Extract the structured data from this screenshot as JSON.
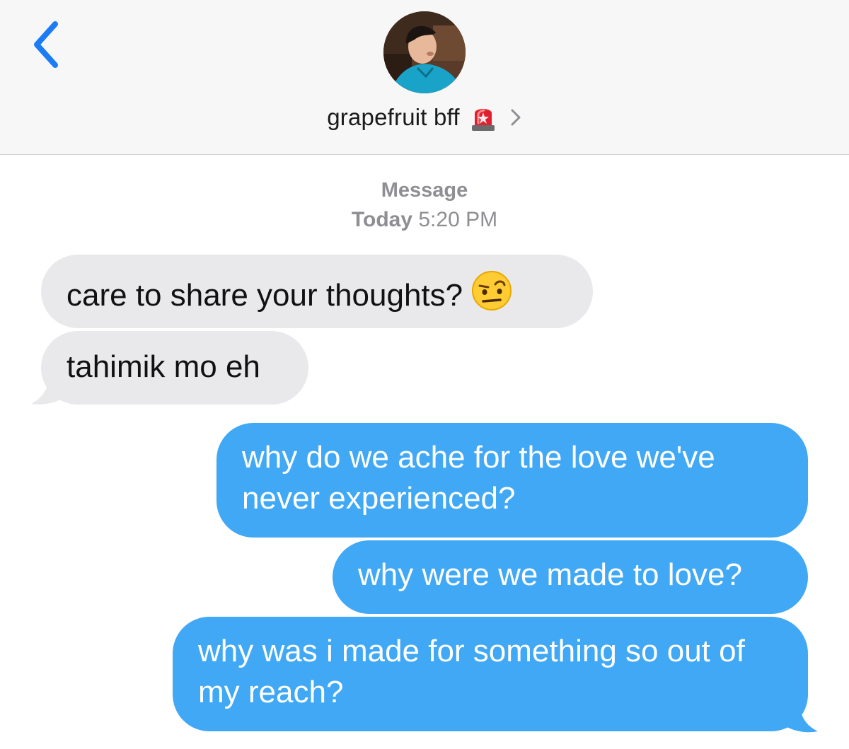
{
  "header": {
    "contact_name": "grapefruit bff",
    "icons": {
      "back": "chevron-left-icon",
      "status_emoji": "police-light-icon",
      "details": "chevron-right-icon"
    },
    "accent_color": "#1b7cf5"
  },
  "thread": {
    "service_label": "Message",
    "day": "Today",
    "time": "5:20 PM"
  },
  "messages": [
    {
      "sender": "contact",
      "text": "care to share your thoughts?",
      "emoji": "face-with-raised-eyebrow-icon"
    },
    {
      "sender": "contact",
      "text": "tahimik mo eh"
    },
    {
      "sender": "me",
      "text": "why do we ache for the love we've never experienced?"
    },
    {
      "sender": "me",
      "text": "why were we made to love?"
    },
    {
      "sender": "me",
      "text": "why was i made for something so out of my reach?"
    }
  ],
  "colors": {
    "incoming_bubble": "#e9e9eb",
    "outgoing_bubble": "#40a8f4",
    "meta_text": "#8e8e93"
  }
}
